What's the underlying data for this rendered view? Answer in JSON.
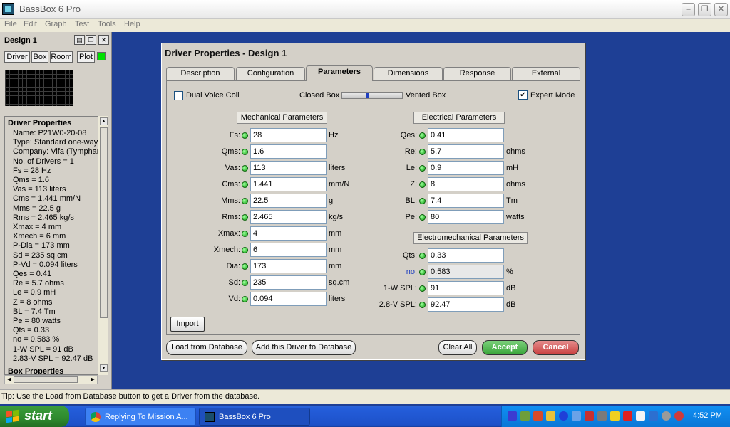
{
  "window": {
    "title": "BassBox 6 Pro"
  },
  "menu": [
    "File",
    "Edit",
    "Graph",
    "Test",
    "Tools",
    "Help"
  ],
  "left_panel": {
    "design_title": "Design 1",
    "tabs": [
      "Driver",
      "Box",
      "Room",
      "Plot"
    ],
    "driver_properties_title": "Driver Properties",
    "lines": [
      "Name: P21W0-20-08",
      "Type: Standard one-way d",
      "Company: Vifa  (Tympham",
      "No. of Drivers = 1",
      "Fs = 28 Hz",
      "Qms = 1.6",
      "Vas = 113 liters",
      "Cms = 1.441 mm/N",
      "Mms = 22.5 g",
      "Rms = 2.465 kg/s",
      "Xmax = 4 mm",
      "Xmech = 6 mm",
      "P-Dia = 173 mm",
      "Sd = 235 sq.cm",
      "P-Vd = 0.094 liters",
      "Qes = 0.41",
      "Re = 5.7 ohms",
      "Le = 0.9 mH",
      "Z = 8 ohms",
      "BL = 7.4 Tm",
      "Pe = 80 watts",
      "Qts = 0.33",
      "no = 0.583 %",
      "1-W SPL = 91 dB",
      "2.83-V SPL = 92.47 dB"
    ],
    "box_properties_title": "Box Properties"
  },
  "dialog": {
    "title": "Driver Properties - Design 1",
    "tabs": [
      "Description",
      "Configuration",
      "Parameters",
      "Dimensions",
      "Response",
      "External"
    ],
    "active_tab": "Parameters",
    "dual_voice_coil": {
      "label": "Dual Voice Coil",
      "checked": false
    },
    "closed_box_label": "Closed Box",
    "vented_box_label": "Vented Box",
    "box_type_slider_value": 0.4,
    "expert_mode": {
      "label": "Expert Mode",
      "checked": true
    },
    "mechanical": {
      "title": "Mechanical Parameters",
      "rows": [
        {
          "label": "Fs:",
          "value": "28",
          "unit": "Hz"
        },
        {
          "label": "Qms:",
          "value": "1.6",
          "unit": ""
        },
        {
          "label": "Vas:",
          "value": "113",
          "unit": "liters"
        },
        {
          "label": "Cms:",
          "value": "1.441",
          "unit": "mm/N"
        },
        {
          "label": "Mms:",
          "value": "22.5",
          "unit": "g"
        },
        {
          "label": "Rms:",
          "value": "2.465",
          "unit": "kg/s"
        },
        {
          "label": "Xmax:",
          "value": "4",
          "unit": "mm"
        },
        {
          "label": "Xmech:",
          "value": "6",
          "unit": "mm"
        },
        {
          "label": "Dia:",
          "value": "173",
          "unit": "mm"
        },
        {
          "label": "Sd:",
          "value": "235",
          "unit": "sq.cm"
        },
        {
          "label": "Vd:",
          "value": "0.094",
          "unit": "liters"
        }
      ]
    },
    "electrical": {
      "title": "Electrical Parameters",
      "rows": [
        {
          "label": "Qes:",
          "value": "0.41",
          "unit": ""
        },
        {
          "label": "Re:",
          "value": "5.7",
          "unit": "ohms"
        },
        {
          "label": "Le:",
          "value": "0.9",
          "unit": "mH"
        },
        {
          "label": "Z:",
          "value": "8",
          "unit": "ohms"
        },
        {
          "label": "BL:",
          "value": "7.4",
          "unit": "Tm"
        },
        {
          "label": "Pe:",
          "value": "80",
          "unit": "watts"
        }
      ]
    },
    "electromechanical": {
      "title": "Electromechanical Parameters",
      "rows": [
        {
          "label": "Qts:",
          "value": "0.33",
          "unit": ""
        },
        {
          "label": "no:",
          "value": "0.583",
          "unit": "%"
        },
        {
          "label": "1-W SPL:",
          "value": "91",
          "unit": "dB"
        },
        {
          "label": "2.8-V SPL:",
          "value": "92.47",
          "unit": "dB"
        }
      ]
    },
    "buttons": {
      "import": "Import",
      "load_db": "Load from Database",
      "add_db": "Add this Driver to Database",
      "clear_all": "Clear All",
      "accept": "Accept",
      "cancel": "Cancel"
    }
  },
  "status_tip": "Tip: Use the Load from Database button to get a Driver from the database.",
  "taskbar": {
    "start": "start",
    "tasks": [
      "Replying To Mission A...",
      "BassBox 6 Pro"
    ],
    "clock": "4:52 PM"
  },
  "colors": {
    "desktop": "#1e3f95",
    "accept": "#3aa53a",
    "cancel": "#c84040",
    "indicator": "#16b316"
  }
}
